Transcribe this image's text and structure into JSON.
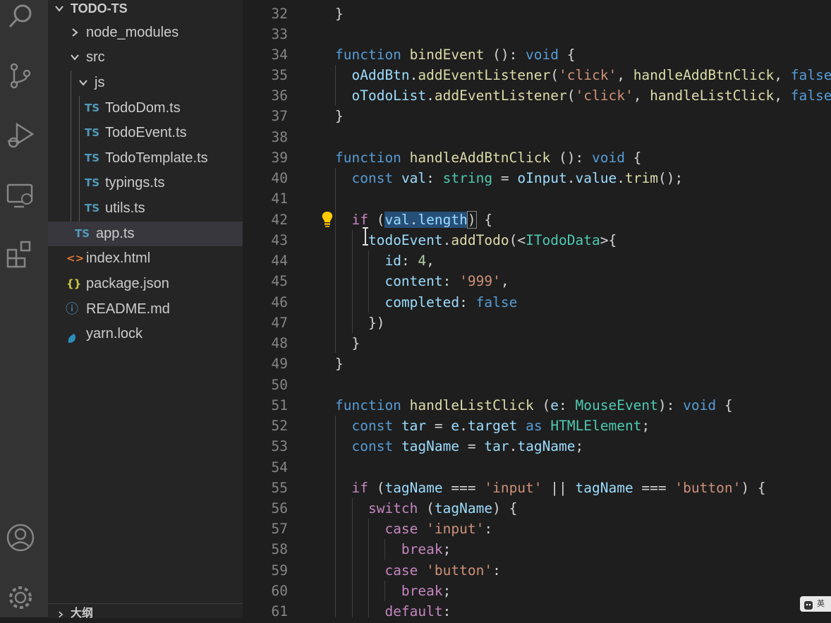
{
  "activity_bar": {
    "icons": [
      "search-icon",
      "source-control-icon",
      "run-debug-icon",
      "remote-explorer-icon",
      "extensions-icon",
      "account-icon",
      "settings-gear-icon"
    ]
  },
  "explorer": {
    "root": "TODO-TS",
    "items": [
      {
        "label": "node_modules",
        "type": "folder",
        "expanded": false
      },
      {
        "label": "src",
        "type": "folder",
        "expanded": true
      },
      {
        "label": "js",
        "type": "folder",
        "expanded": true
      },
      {
        "label": "TodoDom.ts",
        "type": "ts",
        "badge": "TS"
      },
      {
        "label": "TodoEvent.ts",
        "type": "ts",
        "badge": "TS"
      },
      {
        "label": "TodoTemplate.ts",
        "type": "ts",
        "badge": "TS"
      },
      {
        "label": "typings.ts",
        "type": "ts",
        "badge": "TS"
      },
      {
        "label": "utils.ts",
        "type": "ts",
        "badge": "TS"
      },
      {
        "label": "app.ts",
        "type": "ts",
        "badge": "TS",
        "selected": true
      },
      {
        "label": "index.html",
        "type": "html",
        "badge": "<>"
      },
      {
        "label": "package.json",
        "type": "json",
        "badge": "{}"
      },
      {
        "label": "README.md",
        "type": "md",
        "badge": "ⓘ"
      },
      {
        "label": "yarn.lock",
        "type": "yarn"
      }
    ],
    "outline_label": "大纲"
  },
  "editor": {
    "line_numbers": [
      "32",
      "33",
      "34",
      "35",
      "36",
      "37",
      "38",
      "39",
      "40",
      "41",
      "42",
      "43",
      "44",
      "45",
      "46",
      "47",
      "48",
      "49",
      "50",
      "51",
      "52",
      "53",
      "54",
      "55",
      "56",
      "57",
      "58",
      "59",
      "60",
      "61"
    ]
  },
  "corner_widget": {
    "text": "英"
  },
  "colors": {
    "accent_selection": "#264f78",
    "ts_badge": "#519aba"
  }
}
